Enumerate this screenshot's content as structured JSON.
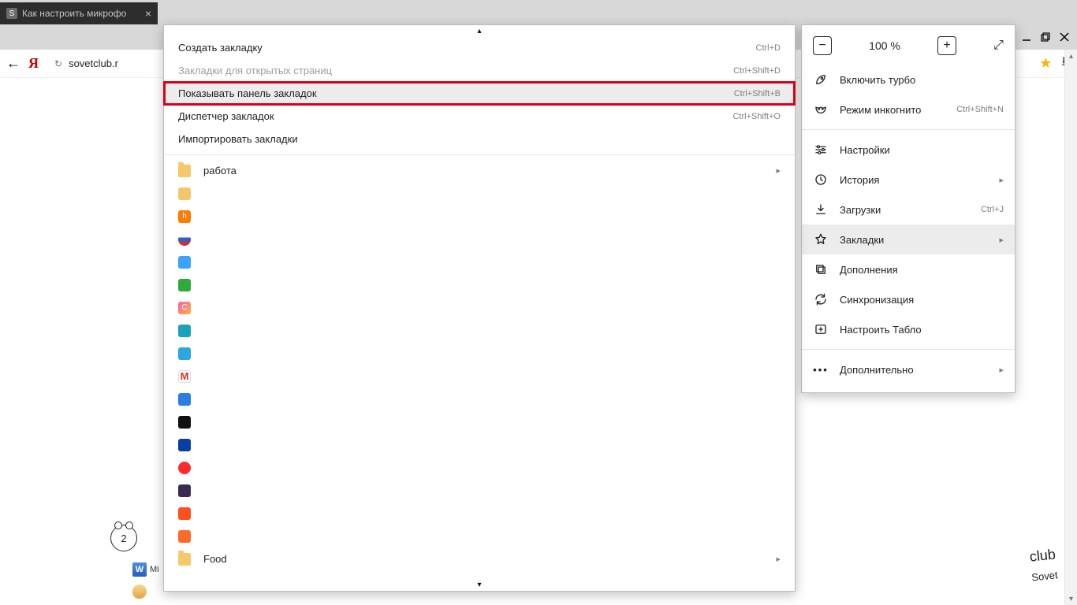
{
  "tab": {
    "favicon_letter": "S",
    "title": "Как настроить микрофо"
  },
  "addressbar": {
    "url": "sovetclub.r"
  },
  "zoom": {
    "value": "100 %"
  },
  "mainMenu": [
    {
      "icon": "rocket",
      "label": "Включить турбо"
    },
    {
      "icon": "mask",
      "label": "Режим инкогнито",
      "kbd": "Ctrl+Shift+N"
    },
    {
      "sep": true
    },
    {
      "icon": "sliders",
      "label": "Настройки"
    },
    {
      "icon": "clock",
      "label": "История",
      "arrow": true
    },
    {
      "icon": "download",
      "label": "Загрузки",
      "kbd": "Ctrl+J"
    },
    {
      "icon": "star",
      "label": "Закладки",
      "arrow": true,
      "hover": true
    },
    {
      "icon": "puzzle",
      "label": "Дополнения"
    },
    {
      "icon": "sync",
      "label": "Синхронизация"
    },
    {
      "icon": "addtab",
      "label": "Настроить Табло"
    },
    {
      "sep": true
    },
    {
      "icon": "dots",
      "label": "Дополнительно",
      "arrow": true
    }
  ],
  "subMenu": {
    "top": [
      {
        "label": "Создать закладку",
        "kbd": "Ctrl+D"
      },
      {
        "label": "Закладки для открытых страниц",
        "kbd": "Ctrl+Shift+D",
        "disabled": true
      },
      {
        "label": "Показывать панель закладок",
        "kbd": "Ctrl+Shift+B",
        "highlight": true
      },
      {
        "label": "Диспетчер закладок",
        "kbd": "Ctrl+Shift+O"
      },
      {
        "label": "Импортировать закладки"
      }
    ],
    "folder1": {
      "label": "работа"
    },
    "favicons": [
      {
        "c": "#f4c56b",
        "t": ""
      },
      {
        "c": "#ff7a00",
        "t": "h"
      },
      {
        "c": "#ffffff",
        "t": "",
        "flag": true
      },
      {
        "c": "#3aa3ff",
        "t": ""
      },
      {
        "c": "#2faa3b",
        "t": ""
      },
      {
        "c": "linear-gradient(135deg,#ff5ea1,#ffb23e)",
        "t": "C"
      },
      {
        "c": "#1aa3b8",
        "t": ""
      },
      {
        "c": "#2aa7e0",
        "t": ""
      },
      {
        "c": "#ffffff",
        "t": "M",
        "gmail": true
      },
      {
        "c": "#2b7de1",
        "t": ""
      },
      {
        "c": "#111111",
        "t": ""
      },
      {
        "c": "#0a3ea3",
        "t": ""
      },
      {
        "c": "#ff2b2b",
        "t": "",
        "round": true
      },
      {
        "c": "#3a2a4f",
        "t": ""
      },
      {
        "c": "#ff4f1f",
        "t": ""
      },
      {
        "c": "#ff6a2b",
        "t": ""
      }
    ],
    "folder2": {
      "label": "Food"
    }
  },
  "stepBadge": "2",
  "taskbar": {
    "word_label": "Mi"
  },
  "watermark": {
    "l1": "club",
    "l2": "Sovet"
  }
}
